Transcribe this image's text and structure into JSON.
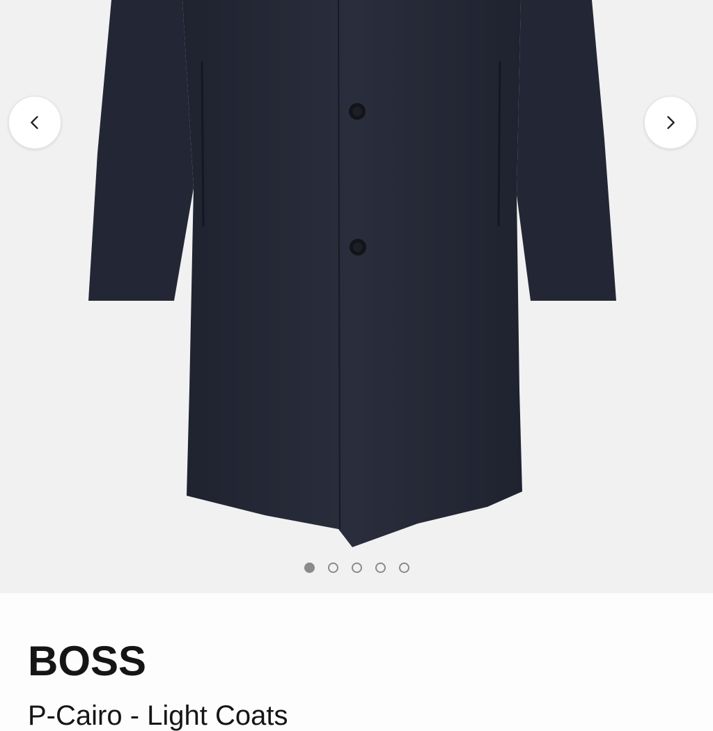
{
  "gallery": {
    "image_alt": "Navy light coat, front view",
    "prev_icon": "chevron-left-icon",
    "next_icon": "chevron-right-icon",
    "dots": [
      {
        "active": true
      },
      {
        "active": false
      },
      {
        "active": false
      },
      {
        "active": false
      },
      {
        "active": false
      }
    ],
    "colors": {
      "background": "#f2f1f1",
      "coat": "#262a37",
      "dot": "#8a8a8a"
    }
  },
  "product": {
    "brand": "BOSS",
    "name": "P-Cairo - Light Coats"
  }
}
